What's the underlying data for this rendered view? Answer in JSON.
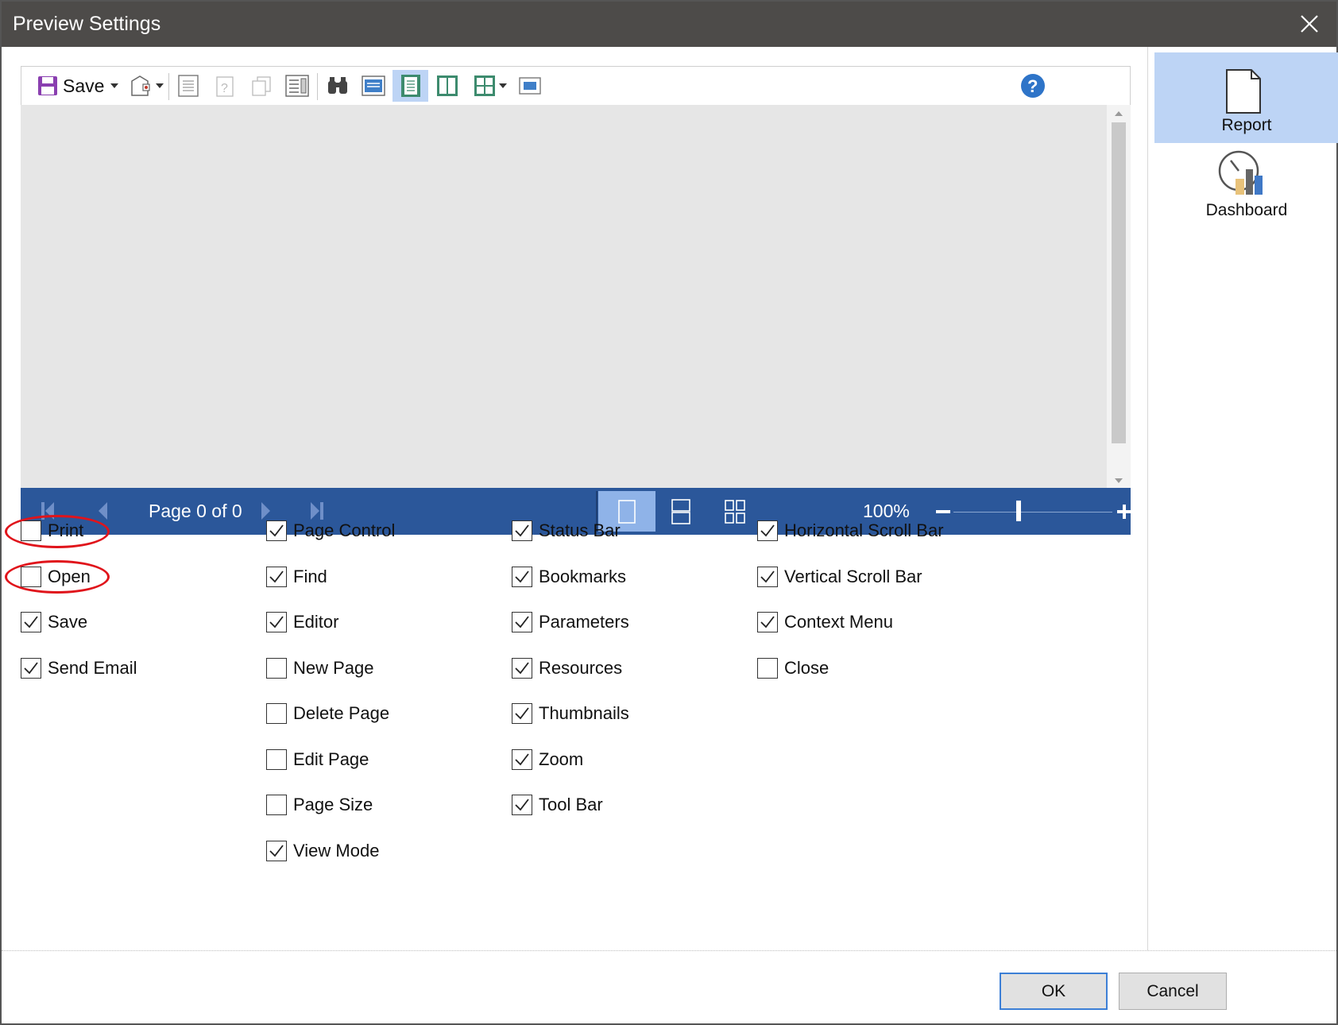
{
  "window": {
    "title": "Preview Settings"
  },
  "sidebar": {
    "items": [
      {
        "label": "Report",
        "icon": "report-page-icon",
        "active": true
      },
      {
        "label": "Dashboard",
        "icon": "dashboard-gauge-icon",
        "active": false
      }
    ]
  },
  "preview": {
    "toolbar": {
      "save_label": "Save",
      "icons": [
        "save-icon",
        "open-icon",
        "page-setup-icon",
        "help-icon",
        "copy-icon",
        "parameters-icon",
        "find-icon",
        "editor-icon",
        "single-page-icon",
        "two-page-icon",
        "multi-page-icon",
        "full-screen-icon"
      ]
    },
    "statusbar": {
      "page_text": "Page 0 of 0",
      "zoom_text": "100%"
    }
  },
  "options": {
    "col1": [
      {
        "label": "Print",
        "checked": false
      },
      {
        "label": "Open",
        "checked": false
      },
      {
        "label": "Save",
        "checked": true
      },
      {
        "label": "Send Email",
        "checked": true
      }
    ],
    "col2": [
      {
        "label": "Page Control",
        "checked": true
      },
      {
        "label": "Find",
        "checked": true
      },
      {
        "label": "Editor",
        "checked": true
      },
      {
        "label": "New Page",
        "checked": false
      },
      {
        "label": "Delete Page",
        "checked": false
      },
      {
        "label": "Edit Page",
        "checked": false
      },
      {
        "label": "Page Size",
        "checked": false
      },
      {
        "label": "View Mode",
        "checked": true
      }
    ],
    "col3": [
      {
        "label": "Status Bar",
        "checked": true
      },
      {
        "label": "Bookmarks",
        "checked": true
      },
      {
        "label": "Parameters",
        "checked": true
      },
      {
        "label": "Resources",
        "checked": true
      },
      {
        "label": "Thumbnails",
        "checked": true
      },
      {
        "label": "Zoom",
        "checked": true
      },
      {
        "label": "Tool Bar",
        "checked": true
      }
    ],
    "col4": [
      {
        "label": "Horizontal Scroll Bar",
        "checked": true
      },
      {
        "label": "Vertical Scroll Bar",
        "checked": true
      },
      {
        "label": "Context Menu",
        "checked": true
      },
      {
        "label": "Close",
        "checked": false
      }
    ]
  },
  "annotations": {
    "highlight_color": "#e0141b",
    "highlighted_options": [
      "Print",
      "Open"
    ]
  },
  "buttons": {
    "ok_label": "OK",
    "cancel_label": "Cancel"
  },
  "colors": {
    "titlebar": "#4d4b49",
    "statusbar": "#2b579a",
    "active_sidebar": "#bdd4f5"
  }
}
